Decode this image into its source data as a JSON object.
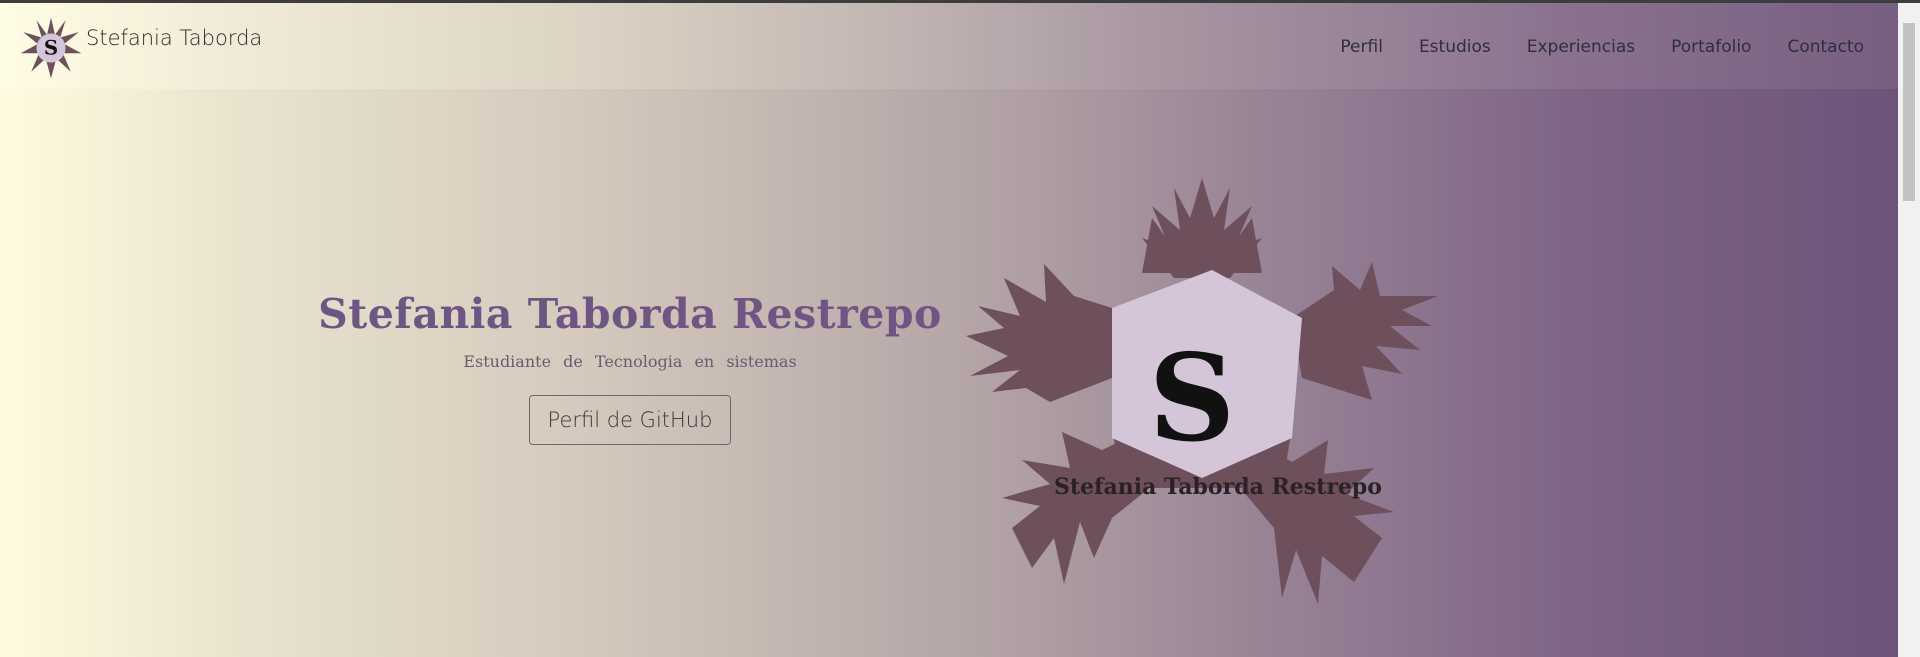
{
  "header": {
    "brand_name": "Stefania Taborda",
    "logo_letter": "S",
    "nav": [
      {
        "label": "Perfil"
      },
      {
        "label": "Estudios"
      },
      {
        "label": "Experiencias"
      },
      {
        "label": "Portafolio"
      },
      {
        "label": "Contacto"
      }
    ]
  },
  "hero": {
    "title": "Stefania Taborda Restrepo",
    "subtitle": "Estudiante de Tecnologia en sistemas",
    "button_label": "Perfil de GitHub",
    "logo_letter": "S",
    "logo_caption": "Stefania Taborda Restrepo"
  },
  "colors": {
    "accent": "#6f5584",
    "logo_splash": "#6e505c",
    "logo_center": "#d4c6d8"
  }
}
